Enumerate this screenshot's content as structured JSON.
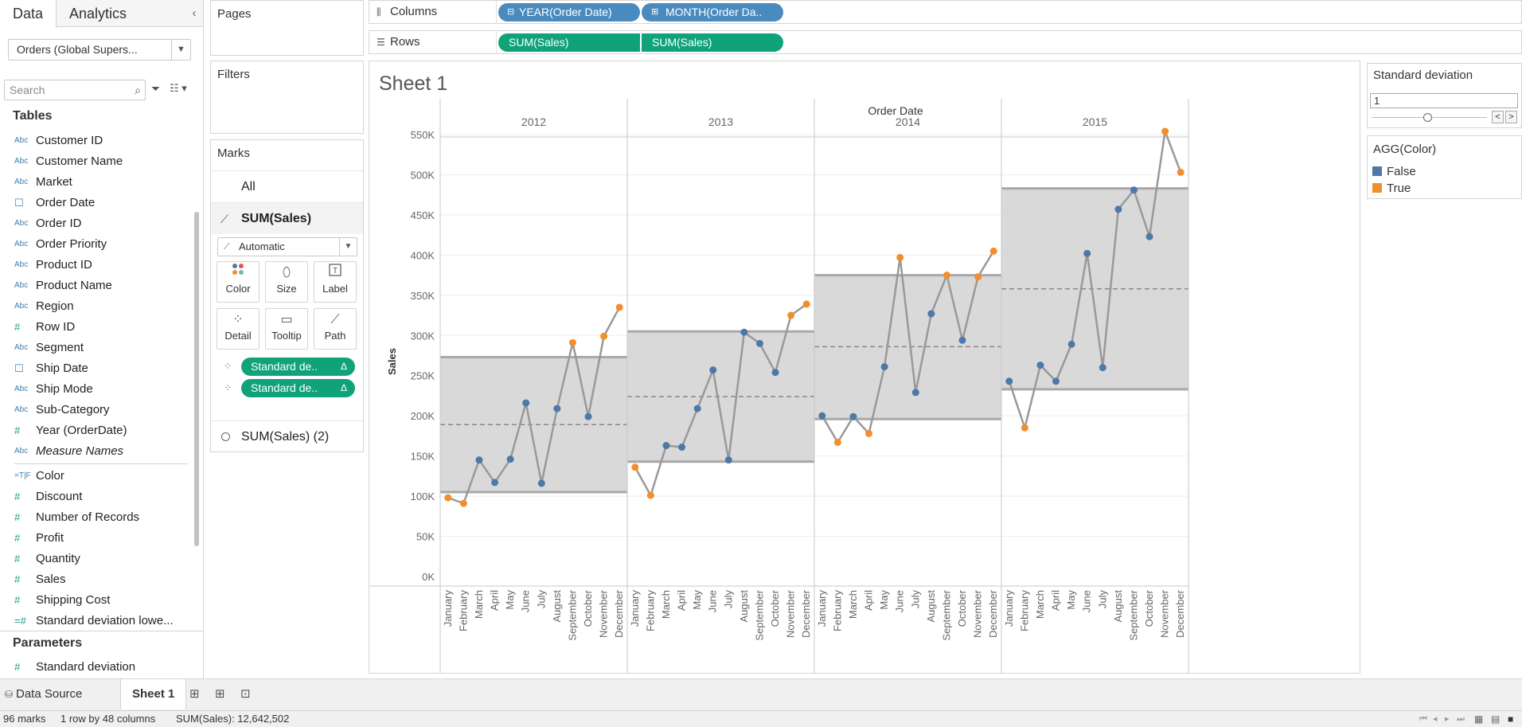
{
  "data_pane": {
    "tabs": [
      "Data",
      "Analytics"
    ],
    "collapse_glyph": "‹",
    "datasource": "Orders (Global Supers...",
    "search_placeholder": "Search",
    "tables_header": "Tables",
    "parameters_header": "Parameters",
    "dimensions": [
      {
        "icon": "Abc",
        "name": "Customer ID"
      },
      {
        "icon": "Abc",
        "name": "Customer Name"
      },
      {
        "icon": "Abc",
        "name": "Market"
      },
      {
        "icon": "cal",
        "name": "Order Date"
      },
      {
        "icon": "Abc",
        "name": "Order ID"
      },
      {
        "icon": "Abc",
        "name": "Order Priority"
      },
      {
        "icon": "Abc",
        "name": "Product ID"
      },
      {
        "icon": "Abc",
        "name": "Product Name"
      },
      {
        "icon": "Abc",
        "name": "Region"
      },
      {
        "icon": "#",
        "name": "Row ID"
      },
      {
        "icon": "Abc",
        "name": "Segment"
      },
      {
        "icon": "cal",
        "name": "Ship Date"
      },
      {
        "icon": "Abc",
        "name": "Ship Mode"
      },
      {
        "icon": "Abc",
        "name": "Sub-Category"
      },
      {
        "icon": "#",
        "name": "Year (OrderDate)"
      },
      {
        "icon": "Abc",
        "name": "Measure Names",
        "italic": true
      }
    ],
    "measures": [
      {
        "icon": "=T|F",
        "name": "Color"
      },
      {
        "icon": "#",
        "name": "Discount"
      },
      {
        "icon": "#",
        "name": "Number of Records"
      },
      {
        "icon": "#",
        "name": "Profit"
      },
      {
        "icon": "#",
        "name": "Quantity"
      },
      {
        "icon": "#",
        "name": "Sales"
      },
      {
        "icon": "#",
        "name": "Shipping Cost"
      },
      {
        "icon": "=#",
        "name": "Standard deviation lowe..."
      }
    ],
    "parameters": [
      {
        "icon": "#",
        "name": "Standard deviation"
      }
    ]
  },
  "cards": {
    "pages": "Pages",
    "filters": "Filters",
    "marks": "Marks",
    "marks_all": "All",
    "marks_sum": "SUM(Sales)",
    "mark_type": "Automatic",
    "buttons": [
      "Color",
      "Size",
      "Label",
      "Detail",
      "Tooltip",
      "Path"
    ],
    "detail_pills": [
      "Standard de..",
      "Standard de.."
    ],
    "delta_glyph": "Δ",
    "marks_sum2": "SUM(Sales) (2)"
  },
  "shelves": {
    "columns_label": "Columns",
    "rows_label": "Rows",
    "columns": [
      "YEAR(Order Date)",
      "MONTH(Order Da.."
    ],
    "column_toggles": [
      "⊟",
      "⊞"
    ],
    "rows": [
      "SUM(Sales)",
      "SUM(Sales)"
    ]
  },
  "view": {
    "sheet_title": "Sheet 1",
    "header_title": "Order Date",
    "y_axis_title": "Sales"
  },
  "parameter_control": {
    "title": "Standard deviation",
    "value": "1"
  },
  "legend": {
    "title": "AGG(Color)",
    "items": [
      {
        "label": "False",
        "color": "#4e79a7"
      },
      {
        "label": "True",
        "color": "#f28e2b"
      }
    ]
  },
  "sheet_tabs": {
    "data_source": "Data Source",
    "active": "Sheet 1"
  },
  "status": {
    "marks": "96 marks",
    "dims": "1 row by 48 columns",
    "sum": "SUM(Sales): 12,642,502"
  },
  "chart_data": {
    "type": "line",
    "title": "Sheet 1",
    "header": "Order Date",
    "ylabel": "Sales",
    "ylim": [
      0,
      580000
    ],
    "y_ticks": [
      "0K",
      "50K",
      "100K",
      "150K",
      "200K",
      "250K",
      "300K",
      "350K",
      "400K",
      "450K",
      "500K",
      "550K"
    ],
    "y_tick_values": [
      0,
      50000,
      100000,
      150000,
      200000,
      250000,
      300000,
      350000,
      400000,
      450000,
      500000,
      550000
    ],
    "months": [
      "January",
      "February",
      "March",
      "April",
      "May",
      "June",
      "July",
      "August",
      "September",
      "October",
      "November",
      "December"
    ],
    "line_color": "#999999",
    "colors": {
      "False": "#4e79a7",
      "True": "#f28e2b"
    },
    "panels": [
      {
        "year": "2012",
        "values": [
          98000,
          91000,
          145000,
          117000,
          146000,
          216000,
          116000,
          209000,
          291000,
          199000,
          299000,
          335000
        ],
        "flags": [
          true,
          true,
          false,
          false,
          false,
          false,
          false,
          false,
          true,
          false,
          true,
          true
        ],
        "mean": 189000,
        "upper": 273000,
        "lower": 105000
      },
      {
        "year": "2013",
        "values": [
          136000,
          101000,
          163000,
          161000,
          209000,
          257000,
          145000,
          304000,
          290000,
          254000,
          325000,
          339000
        ],
        "flags": [
          true,
          true,
          false,
          false,
          false,
          false,
          false,
          false,
          false,
          false,
          true,
          true
        ],
        "mean": 224000,
        "upper": 305000,
        "lower": 143000
      },
      {
        "year": "2014",
        "values": [
          200000,
          167000,
          199000,
          178000,
          261000,
          397000,
          229000,
          327000,
          375000,
          294000,
          373000,
          405000
        ],
        "flags": [
          false,
          true,
          false,
          true,
          false,
          true,
          false,
          false,
          true,
          false,
          true,
          true
        ],
        "mean": 286000,
        "upper": 375000,
        "lower": 196000
      },
      {
        "year": "2015",
        "values": [
          243000,
          185000,
          263000,
          243000,
          289000,
          402000,
          260000,
          457000,
          481000,
          423000,
          554000,
          503000
        ],
        "flags": [
          false,
          true,
          false,
          false,
          false,
          false,
          false,
          false,
          false,
          false,
          true,
          true
        ],
        "mean": 358000,
        "upper": 483000,
        "lower": 233000
      }
    ]
  }
}
